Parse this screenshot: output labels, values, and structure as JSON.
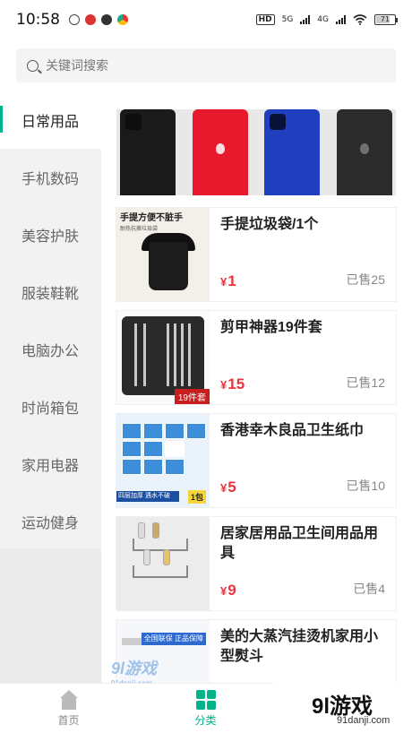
{
  "status": {
    "time": "10:58",
    "network_5g": "5G",
    "network_4g": "4G",
    "battery": "71"
  },
  "search": {
    "placeholder": "关键词搜索"
  },
  "sidebar": {
    "items": [
      {
        "label": "日常用品",
        "active": true
      },
      {
        "label": "手机数码"
      },
      {
        "label": "美容护肤"
      },
      {
        "label": "服装鞋靴"
      },
      {
        "label": "电脑办公"
      },
      {
        "label": "时尚箱包"
      },
      {
        "label": "家用电器"
      },
      {
        "label": "运动健身"
      }
    ]
  },
  "banner": {
    "phone_colors": [
      "#1a1a1a",
      "#e8192c",
      "#1f3fbf",
      "#2b2b2b"
    ]
  },
  "products": [
    {
      "title": "手提垃圾袋/1个",
      "currency": "¥",
      "price": "1",
      "sold": "已售25",
      "thumb_text": "手提方便不脏手",
      "thumb_sub": "耐热抗撕垃圾袋"
    },
    {
      "title": "剪甲神器19件套",
      "currency": "¥",
      "price": "15",
      "sold": "已售12",
      "thumb_tag": "19件套"
    },
    {
      "title": "香港幸木良品卫生纸巾",
      "currency": "¥",
      "price": "5",
      "sold": "已售10",
      "thumb_strip": "四层加厚 遇水不破",
      "thumb_badge": "1包"
    },
    {
      "title": "居家居用品卫生间用品用具",
      "currency": "¥",
      "price": "9",
      "sold": "已售4"
    },
    {
      "title": "美的大蒸汽挂烫机家用小型熨斗",
      "thumb_label": "全国联保 正品保障"
    }
  ],
  "watermark": {
    "left_text": "9l游戏",
    "left_url": "91danji.com",
    "brand": "9l游戏",
    "brand_url": "91danji.com"
  },
  "tabbar": {
    "home": "首页",
    "category": "分类"
  },
  "colors": {
    "accent": "#00b38a",
    "price": "#e8343d"
  }
}
